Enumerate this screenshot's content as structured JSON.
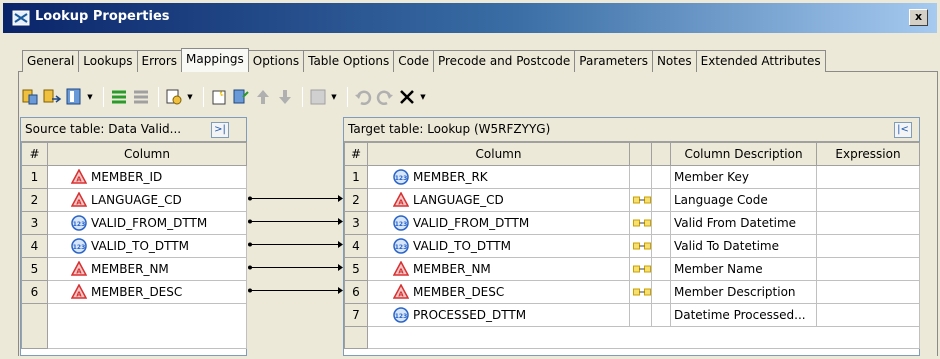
{
  "window": {
    "title": "Lookup Properties",
    "close_label": "x"
  },
  "tabs": [
    {
      "label": "General",
      "active": false
    },
    {
      "label": "Lookups",
      "active": false
    },
    {
      "label": "Errors",
      "active": false
    },
    {
      "label": "Mappings",
      "active": true
    },
    {
      "label": "Options",
      "active": false
    },
    {
      "label": "Table Options",
      "active": false
    },
    {
      "label": "Code",
      "active": false
    },
    {
      "label": "Precode and Postcode",
      "active": false
    },
    {
      "label": "Parameters",
      "active": false
    },
    {
      "label": "Notes",
      "active": false
    },
    {
      "label": "Extended Attributes",
      "active": false
    }
  ],
  "toolbar": {
    "icons": [
      "import-columns-icon",
      "export-columns-icon",
      "column-layout-icon",
      "map-all-icon",
      "unmap-icon",
      "derived-mapping-icon",
      "new-column-icon",
      "propagate-icon",
      "move-up-icon",
      "move-down-icon",
      "expression-icon",
      "undo-icon",
      "redo-icon",
      "delete-icon"
    ]
  },
  "source": {
    "header": "Source table: Data Valid...",
    "columns": [
      "#",
      "Column"
    ],
    "rows": [
      {
        "num": "1",
        "name": "MEMBER_ID",
        "type": "char"
      },
      {
        "num": "2",
        "name": "LANGUAGE_CD",
        "type": "char"
      },
      {
        "num": "3",
        "name": "VALID_FROM_DTTM",
        "type": "numeric"
      },
      {
        "num": "4",
        "name": "VALID_TO_DTTM",
        "type": "numeric"
      },
      {
        "num": "5",
        "name": "MEMBER_NM",
        "type": "char"
      },
      {
        "num": "6",
        "name": "MEMBER_DESC",
        "type": "char"
      }
    ]
  },
  "target": {
    "header": "Target table: Lookup (W5RFZYYG)",
    "columns": [
      "#",
      "Column",
      "",
      "",
      "Column Description",
      "Expression"
    ],
    "rows": [
      {
        "num": "1",
        "name": "MEMBER_RK",
        "type": "numeric",
        "mapped": false,
        "desc": "Member Key",
        "expr": ""
      },
      {
        "num": "2",
        "name": "LANGUAGE_CD",
        "type": "char",
        "mapped": true,
        "desc": "Language Code",
        "expr": ""
      },
      {
        "num": "3",
        "name": "VALID_FROM_DTTM",
        "type": "numeric",
        "mapped": true,
        "desc": "Valid From Datetime",
        "expr": ""
      },
      {
        "num": "4",
        "name": "VALID_TO_DTTM",
        "type": "numeric",
        "mapped": true,
        "desc": "Valid To Datetime",
        "expr": ""
      },
      {
        "num": "5",
        "name": "MEMBER_NM",
        "type": "char",
        "mapped": true,
        "desc": "Member Name",
        "expr": ""
      },
      {
        "num": "6",
        "name": "MEMBER_DESC",
        "type": "char",
        "mapped": true,
        "desc": "Member Description",
        "expr": ""
      },
      {
        "num": "7",
        "name": "PROCESSED_DTTM",
        "type": "numeric",
        "mapped": false,
        "desc": "Datetime Processed...",
        "expr": ""
      }
    ]
  },
  "mappings": [
    {
      "from": "2",
      "to": "2"
    },
    {
      "from": "3",
      "to": "3"
    },
    {
      "from": "4",
      "to": "4"
    },
    {
      "from": "5",
      "to": "5"
    },
    {
      "from": "6",
      "to": "6"
    }
  ],
  "colors": {
    "title_start": "#0a246a",
    "title_end": "#a6caf0",
    "char_icon": "#d83030",
    "numeric_icon": "#2a64c8",
    "map_icon": "#c8a000"
  }
}
